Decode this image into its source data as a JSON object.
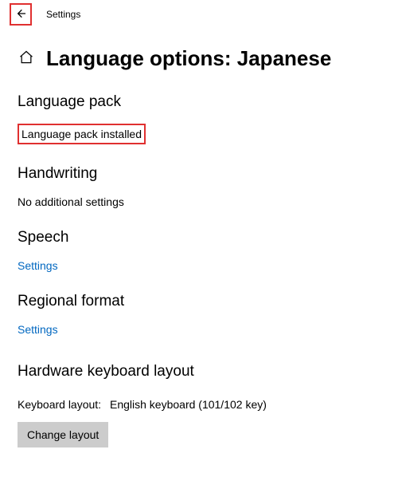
{
  "titlebar": {
    "app_title": "Settings"
  },
  "header": {
    "page_title": "Language options: Japanese"
  },
  "sections": {
    "language_pack": {
      "heading": "Language pack",
      "status": "Language pack installed"
    },
    "handwriting": {
      "heading": "Handwriting",
      "status": "No additional settings"
    },
    "speech": {
      "heading": "Speech",
      "link": "Settings"
    },
    "regional_format": {
      "heading": "Regional format",
      "link": "Settings"
    },
    "hardware_keyboard": {
      "heading": "Hardware keyboard layout",
      "label": "Keyboard layout:",
      "value": "English keyboard (101/102 key)",
      "button": "Change layout"
    }
  }
}
